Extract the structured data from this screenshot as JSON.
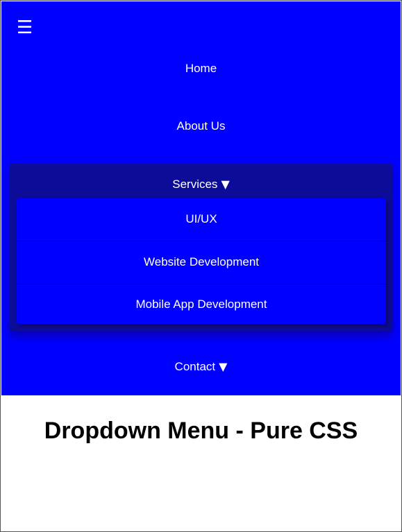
{
  "nav": {
    "menu_icon": "hamburger-icon",
    "menu_glyph": "☰",
    "home_label": "Home",
    "about_label": "About Us",
    "services_label": "Services",
    "contact_label": "Contact",
    "dropdown_arrow_icon": "triangle-down-icon",
    "dropdown_arrow_glyph": "▼",
    "services_submenu": [
      {
        "label": "UI/UX"
      },
      {
        "label": "Website Development"
      },
      {
        "label": "Mobile App Development"
      }
    ]
  },
  "main": {
    "heading": "Dropdown Menu - Pure CSS"
  },
  "colors": {
    "navbar_bg": "#0000ff",
    "dropdown_panel_bg": "#0c0c99",
    "text": "#ffffff",
    "heading_text": "#000000"
  }
}
